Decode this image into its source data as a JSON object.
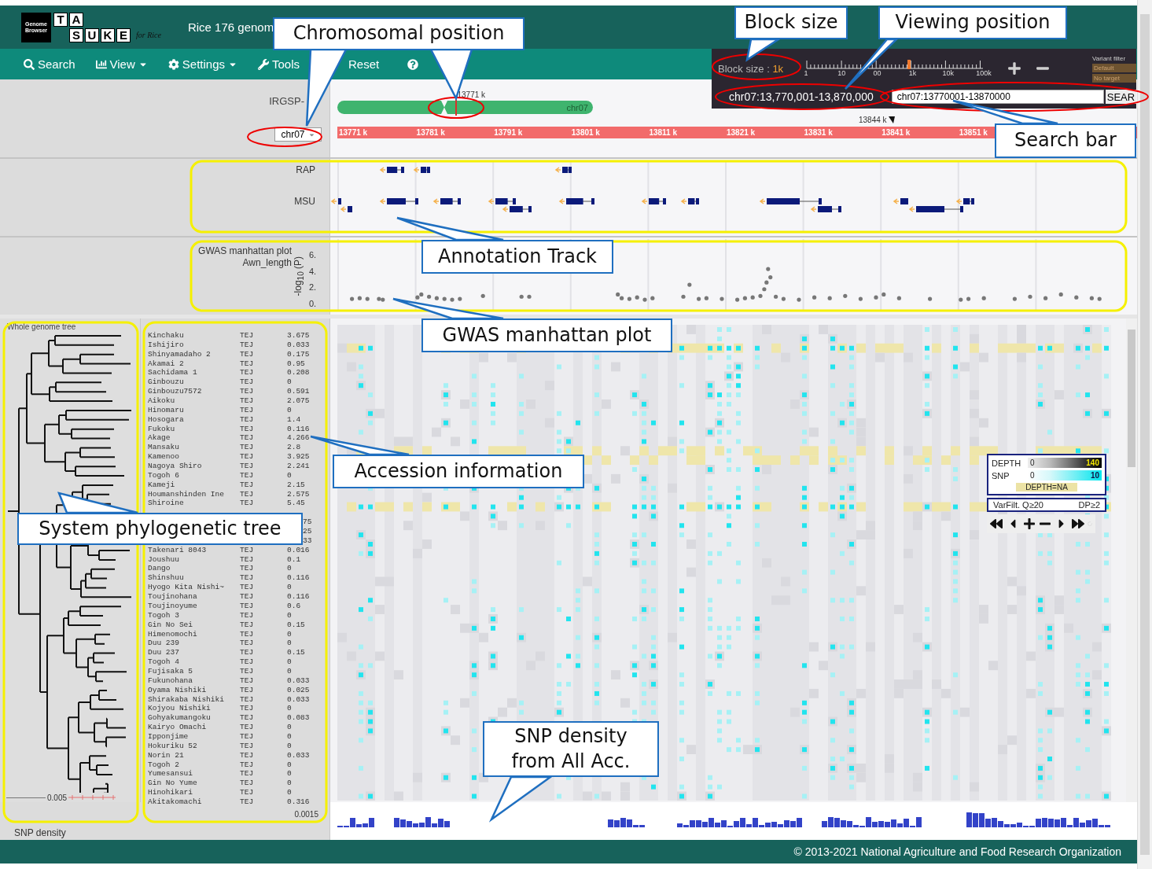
{
  "header": {
    "logo": {
      "badge": "Genome Browser",
      "top_letters": [
        "T",
        "A"
      ],
      "bottom_letters": [
        "S",
        "U",
        "K",
        "E"
      ],
      "tagline": "for Rice"
    },
    "title": "Rice 176 genom"
  },
  "nav": [
    {
      "label": "Search",
      "dropdown": false
    },
    {
      "label": "View",
      "dropdown": true
    },
    {
      "label": "Settings",
      "dropdown": true
    },
    {
      "label": "Tools",
      "dropdown": false
    },
    {
      "label": "Reset",
      "dropdown": false
    }
  ],
  "controls": {
    "block_size_label": "Block size :",
    "block_size_value": "1k",
    "block_scale": {
      "ticks": [
        "1",
        "10",
        "00",
        "1k",
        "10k",
        "100k"
      ],
      "level": 0.58
    },
    "variant_filter": {
      "title": "Variant filter",
      "options": [
        "Default",
        "No target"
      ]
    },
    "viewing_position": "chr07:13,770,001-13,870,000",
    "search_value": "chr07:13770001-13870000",
    "search_button": "SEAR"
  },
  "chromosome": {
    "assembly_label": "IRGSP-",
    "chromosome_select": "chr07",
    "chromosome_label": "chr07",
    "position_label": "13771 k",
    "ruler_ticks": [
      "13771 k",
      "13781 k",
      "13791 k",
      "13801 k",
      "13811 k",
      "13821 k",
      "13831 k",
      "13841 k",
      "13851 k"
    ],
    "cursor_label": "13844 k"
  },
  "tracks": [
    {
      "label": "RAP"
    },
    {
      "label": "MSU"
    }
  ],
  "gwas": {
    "title": "GWAS manhattan plot",
    "trait": "Awn_length",
    "y_axis_label": "-log$_{10}$ (P)",
    "y_ticks": [
      "6.",
      "4.",
      "2.",
      "0."
    ]
  },
  "tree": {
    "title": "Whole genome tree",
    "scale": "0.005"
  },
  "accessions": [
    {
      "kind": "full",
      "name": "Kinchaku",
      "group": "TEJ",
      "value": "3.675"
    },
    {
      "kind": "full",
      "name": "Ishijiro",
      "group": "TEJ",
      "value": "0.033"
    },
    {
      "kind": "full",
      "name": "Shinyamadaho 2",
      "group": "TEJ",
      "value": "0.175"
    },
    {
      "kind": "full",
      "name": "Akamai 2",
      "group": "TEJ",
      "value": "0.95"
    },
    {
      "kind": "full",
      "name": "Sachidama 1",
      "group": "TEJ",
      "value": "0.208"
    },
    {
      "kind": "full",
      "name": "Ginbouzu",
      "group": "TEJ",
      "value": "0"
    },
    {
      "kind": "full",
      "name": "Ginbouzu7572",
      "group": "TEJ",
      "value": "0.591"
    },
    {
      "kind": "full",
      "name": "Aikoku",
      "group": "TEJ",
      "value": "2.075"
    },
    {
      "kind": "full",
      "name": "Hinomaru",
      "group": "TEJ",
      "value": "0"
    },
    {
      "kind": "full",
      "name": "Hosogara",
      "group": "TEJ",
      "value": "1.4"
    },
    {
      "kind": "full",
      "name": "Fukoku",
      "group": "TEJ",
      "value": "0.116"
    },
    {
      "kind": "full",
      "name": "Akage",
      "group": "TEJ",
      "value": "4.266"
    },
    {
      "kind": "full",
      "name": "Mansaku",
      "group": "TEJ",
      "value": "2.8"
    },
    {
      "kind": "full",
      "name": "Kamenoo",
      "group": "TEJ",
      "value": "3.925"
    },
    {
      "kind": "full",
      "name": "Nagoya Shiro",
      "group": "TEJ",
      "value": "2.241"
    },
    {
      "kind": "full",
      "name": "Togoh 6",
      "group": "TEJ",
      "value": "0"
    },
    {
      "kind": "full",
      "name": "Kameji",
      "group": "TEJ",
      "value": "2.15"
    },
    {
      "kind": "full",
      "name": "Houmanshinden Ine",
      "group": "TEJ",
      "value": "2.575"
    },
    {
      "kind": "full",
      "name": "Shiroine",
      "group": "TEJ",
      "value": "5.45"
    },
    {
      "kind": "covered"
    },
    {
      "kind": "partial",
      "value": "75"
    },
    {
      "kind": "partial",
      "value": "25"
    },
    {
      "kind": "partial",
      "value": "33"
    },
    {
      "kind": "full",
      "name": "Takenari 8043",
      "group": "TEJ",
      "value": "0.016"
    },
    {
      "kind": "full",
      "name": "Joushuu",
      "group": "TEJ",
      "value": "0.1"
    },
    {
      "kind": "full",
      "name": "Dango",
      "group": "TEJ",
      "value": "0"
    },
    {
      "kind": "full",
      "name": "Shinshuu",
      "group": "TEJ",
      "value": "0.116"
    },
    {
      "kind": "full",
      "name": "Hyogo Kita Nishi~",
      "group": "TEJ",
      "value": "0"
    },
    {
      "kind": "full",
      "name": "Toujinohana",
      "group": "TEJ",
      "value": "0.116"
    },
    {
      "kind": "full",
      "name": "Toujinoyume",
      "group": "TEJ",
      "value": "0.6"
    },
    {
      "kind": "full",
      "name": "Togoh 3",
      "group": "TEJ",
      "value": "0"
    },
    {
      "kind": "full",
      "name": "Gin No Sei",
      "group": "TEJ",
      "value": "0.15"
    },
    {
      "kind": "full",
      "name": "Himenomochi",
      "group": "TEJ",
      "value": "0"
    },
    {
      "kind": "full",
      "name": "Duu 239",
      "group": "TEJ",
      "value": "0"
    },
    {
      "kind": "full",
      "name": "Duu 237",
      "group": "TEJ",
      "value": "0.15"
    },
    {
      "kind": "full",
      "name": "Togoh 4",
      "group": "TEJ",
      "value": "0"
    },
    {
      "kind": "full",
      "name": "Fujisaka 5",
      "group": "TEJ",
      "value": "0"
    },
    {
      "kind": "full",
      "name": "Fukunohana",
      "group": "TEJ",
      "value": "0.033"
    },
    {
      "kind": "full",
      "name": "Oyama Nishiki",
      "group": "TEJ",
      "value": "0.025"
    },
    {
      "kind": "full",
      "name": "Shirakaba Nishiki",
      "group": "TEJ",
      "value": "0.033"
    },
    {
      "kind": "full",
      "name": "Kojyou Nishiki",
      "group": "TEJ",
      "value": "0"
    },
    {
      "kind": "full",
      "name": "Gohyakumangoku",
      "group": "TEJ",
      "value": "0.083"
    },
    {
      "kind": "full",
      "name": "Kairyo Omachi",
      "group": "TEJ",
      "value": "0"
    },
    {
      "kind": "full",
      "name": "Ipponjime",
      "group": "TEJ",
      "value": "0"
    },
    {
      "kind": "full",
      "name": "Hokuriku 52",
      "group": "TEJ",
      "value": "0"
    },
    {
      "kind": "full",
      "name": "Norin 21",
      "group": "TEJ",
      "value": "0.033"
    },
    {
      "kind": "full",
      "name": "Togoh 2",
      "group": "TEJ",
      "value": "0"
    },
    {
      "kind": "full",
      "name": "Yumesansui",
      "group": "TEJ",
      "value": "0"
    },
    {
      "kind": "full",
      "name": "Gin No Yume",
      "group": "TEJ",
      "value": "0"
    },
    {
      "kind": "full",
      "name": "Hinohikari",
      "group": "TEJ",
      "value": "0"
    },
    {
      "kind": "full",
      "name": "Akitakomachi",
      "group": "TEJ",
      "value": "0.316"
    }
  ],
  "legend": {
    "depth_label": "DEPTH",
    "depth_min": "0",
    "depth_max": "140",
    "snp_label": "SNP",
    "snp_min": "0",
    "snp_max": "10",
    "na_label": "DEPTH=NA",
    "filter_quality": "VarFilt. Q≥20",
    "filter_depth": "DP≥2"
  },
  "density": {
    "label": "SNP density",
    "max": "0.0015"
  },
  "footer": "© 2013-2021 National Agriculture and Food Research Organization",
  "callouts": [
    {
      "text": "Chromosomal position"
    },
    {
      "text": "Block size"
    },
    {
      "text": "Viewing position"
    },
    {
      "text": "Search bar"
    },
    {
      "text": "Annotation Track"
    },
    {
      "text": "GWAS manhattan plot"
    },
    {
      "text": "Accession information"
    },
    {
      "text": "System phylogenetic tree"
    },
    {
      "text": "SNP density from All Acc."
    }
  ]
}
